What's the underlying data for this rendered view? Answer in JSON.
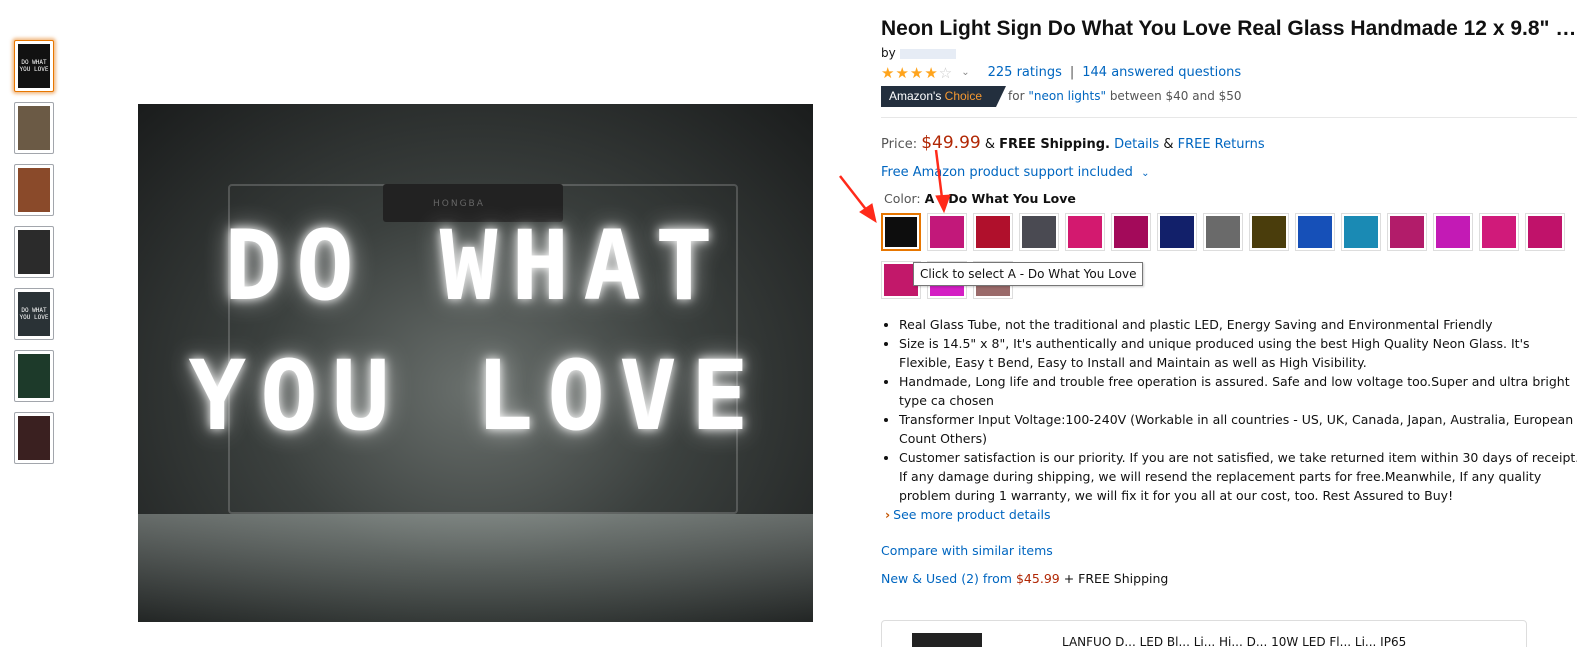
{
  "thumbnails": [
    {
      "label": "DO WHAT YOU LOVE",
      "color": "#111111",
      "selected": true
    },
    {
      "label": "",
      "color": "#6b5a45"
    },
    {
      "label": "",
      "color": "#8a4a2a"
    },
    {
      "label": "",
      "color": "#2b2b2b"
    },
    {
      "label": "DO WHAT YOU LOVE",
      "color": "#2a3236"
    },
    {
      "label": "",
      "color": "#1d3a2a"
    },
    {
      "label": "",
      "color": "#3a2020"
    }
  ],
  "main_image": {
    "line1": "DO WHAT",
    "line2": "YOU LOVE",
    "box_text": "HONGBA"
  },
  "product": {
    "title": "Neon Light Sign Do What You Love Real Glass Handmade 12 x 9.8\" …",
    "by_label": "by",
    "stars": "★★★★",
    "half_star": "☆",
    "ratings": "225 ratings",
    "separator": "|",
    "questions": "144 answered questions",
    "choice_prefix": "Amazon's",
    "choice_word": "Choice",
    "choice_for": "for",
    "choice_query": "\"neon lights\"",
    "choice_range": "between $40 and $50",
    "price_label": "Price:",
    "price": "$49.99",
    "shipping_amp": "&",
    "free_shipping": "FREE Shipping.",
    "details": "Details",
    "amp2": "&",
    "free_returns": "FREE Returns",
    "support": "Free Amazon product support included",
    "color_label": "Color:",
    "color_value": "A - Do What You Love",
    "tooltip": "Click to select A - Do What You Love"
  },
  "swatches": [
    {
      "color": "#0d0d0d",
      "selected": true
    },
    {
      "color": "#c2187a"
    },
    {
      "color": "#b0102c"
    },
    {
      "color": "#4a4a52"
    },
    {
      "color": "#d3196f"
    },
    {
      "color": "#a30a5a"
    },
    {
      "color": "#12206a"
    },
    {
      "color": "#6a6a6a"
    },
    {
      "color": "#4a3d0c"
    },
    {
      "color": "#1650b8"
    },
    {
      "color": "#1a8ab4"
    },
    {
      "color": "#b21c6a"
    },
    {
      "color": "#c31ab5"
    },
    {
      "color": "#d01a7a"
    },
    {
      "color": "#c0126a"
    },
    {
      "color": "#c2186a"
    },
    {
      "color": "#d41fc4"
    },
    {
      "color": "#9a6a6a"
    }
  ],
  "bullets": [
    "Real Glass Tube, not the traditional and plastic LED, Energy Saving and Environmental Friendly",
    "Size is 14.5\" x 8\", It's authentically and unique produced using the best High Quality Neon Glass. It's Flexible, Easy t Bend, Easy to Install and Maintain as well as High Visibility.",
    "Handmade, Long life and trouble free operation is assured. Safe and low voltage too.Super and ultra bright type ca chosen",
    "Transformer Input Voltage:100-240V (Workable in all countries - US, UK, Canada, Japan, Australia, European Count Others)",
    "Customer satisfaction is our priority. If you are not satisfied, we take returned item within 30 days of receipt. If any damage during shipping, we will resend the replacement parts for free.Meanwhile, If any quality problem during 1 warranty, we will fix it for you all at our cost, too. Rest Assured to Buy!"
  ],
  "links": {
    "see_more": "See more product details",
    "compare": "Compare with similar items",
    "new_used": "New & Used (2) from",
    "new_used_price": "$45.99",
    "new_used_shipping": "+ FREE Shipping"
  },
  "bottom_card": {
    "text": "LANFUO D... LED Bl... Li... Hi... D... 10W LED Fl... Li... IP65"
  },
  "colors": {
    "price": "#b12704",
    "link": "#0066c0",
    "selected_border": "#e77600",
    "badge_bg": "#232f3e",
    "badge_accent": "#f69931",
    "arrow": "#ff2a1a"
  }
}
